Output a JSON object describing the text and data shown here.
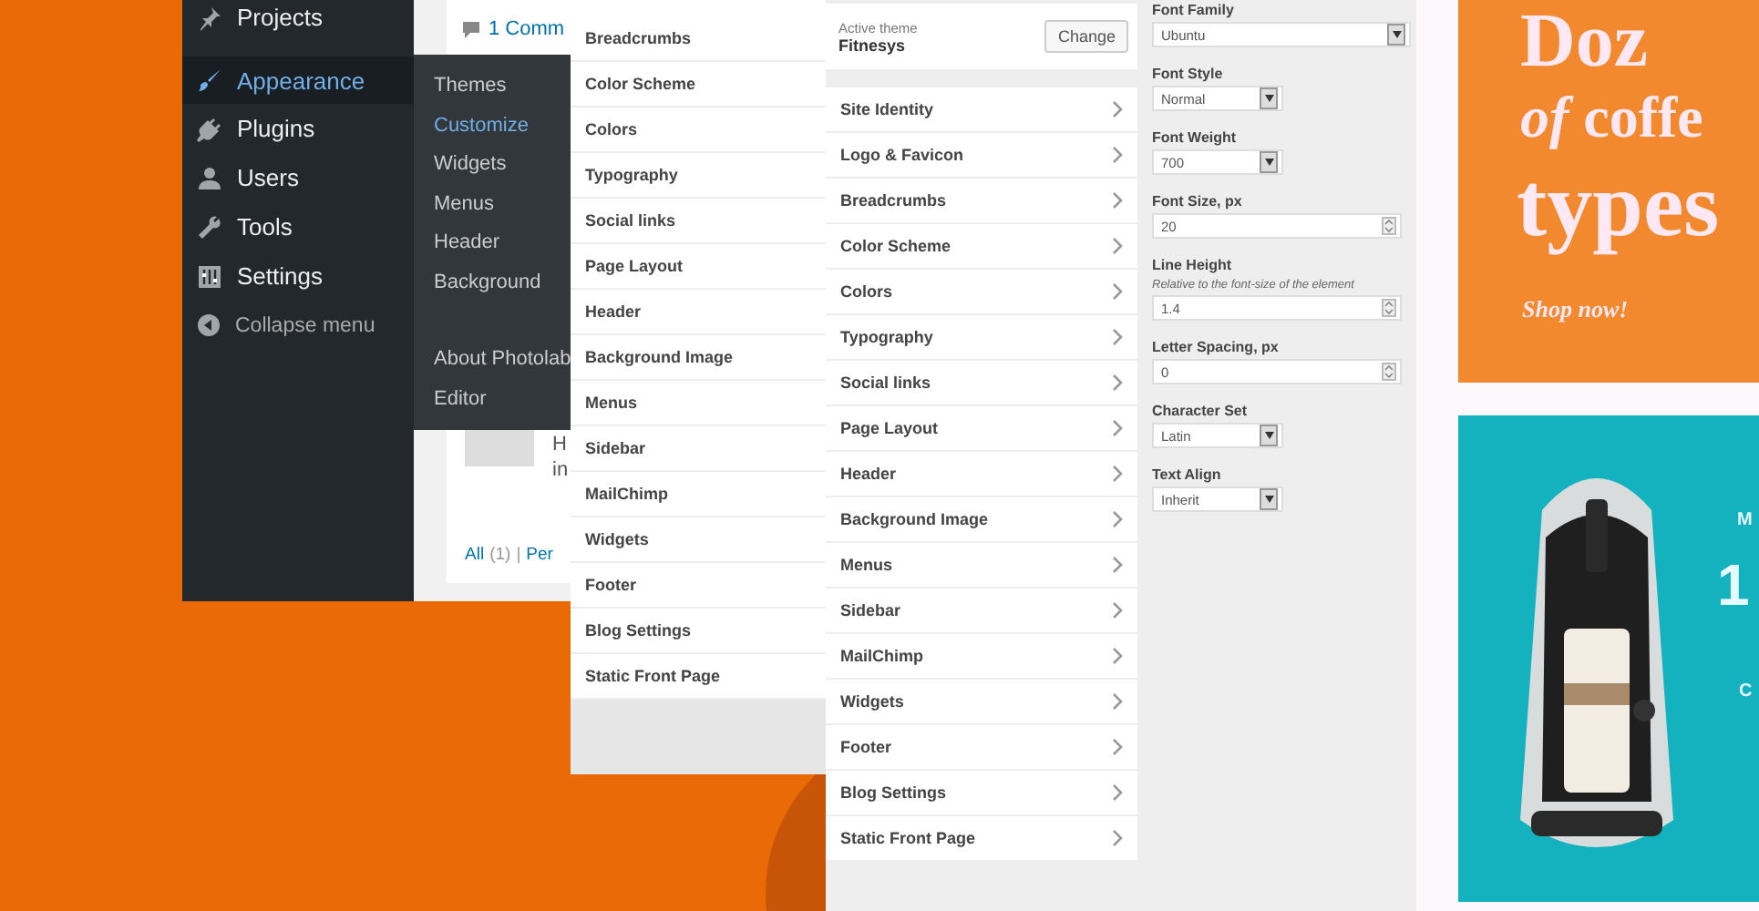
{
  "admin_menu": {
    "items": [
      {
        "label": "Projects",
        "selected": false
      },
      {
        "label": "Appearance",
        "selected": true
      },
      {
        "label": "Plugins",
        "selected": false
      },
      {
        "label": "Users",
        "selected": false
      },
      {
        "label": "Tools",
        "selected": false
      },
      {
        "label": "Settings",
        "selected": false
      }
    ],
    "collapse_label": "Collapse menu"
  },
  "appearance_submenu": {
    "items": [
      {
        "label": "Themes",
        "selected": false
      },
      {
        "label": "Customize",
        "selected": true
      },
      {
        "label": "Widgets",
        "selected": false
      },
      {
        "label": "Menus",
        "selected": false
      },
      {
        "label": "Header",
        "selected": false
      },
      {
        "label": "Background",
        "selected": false
      }
    ],
    "more_items": [
      {
        "label": "About Photolab",
        "selected": false
      },
      {
        "label": "Editor",
        "selected": false
      }
    ]
  },
  "comments": {
    "count_label": "1 Comm",
    "author": "H",
    "excerpt": "in",
    "filter_separator": "|",
    "filters": [
      {
        "label": "All",
        "count": "(1)"
      },
      {
        "label": "Per"
      }
    ]
  },
  "customizer_back_panel": {
    "sections": [
      "Breadcrumbs",
      "Color Scheme",
      "Colors",
      "Typography",
      "Social links",
      "Page Layout",
      "Header",
      "Background Image",
      "Menus",
      "Sidebar",
      "MailChimp",
      "Widgets",
      "Footer",
      "Blog Settings",
      "Static Front Page"
    ]
  },
  "customizer_panel": {
    "active_theme_label": "Active theme",
    "theme_name": "Fitnesys",
    "change_button": "Change",
    "sections": [
      "Site Identity",
      "Logo & Favicon",
      "Breadcrumbs",
      "Color Scheme",
      "Colors",
      "Typography",
      "Social links",
      "Page Layout",
      "Header",
      "Background Image",
      "Menus",
      "Sidebar",
      "MailChimp",
      "Widgets",
      "Footer",
      "Blog Settings",
      "Static Front Page"
    ]
  },
  "typography_panel": {
    "fields": [
      {
        "kind": "select",
        "label": "Font Family",
        "value": "Ubuntu"
      },
      {
        "kind": "select",
        "label": "Font Style",
        "value": "Normal"
      },
      {
        "kind": "select",
        "label": "Font Weight",
        "value": "700"
      },
      {
        "kind": "number",
        "label": "Font Size, px",
        "value": "20"
      },
      {
        "kind": "number",
        "label": "Line Height",
        "hint": "Relative to the font-size of the element",
        "value": "1.4"
      },
      {
        "kind": "number",
        "label": "Letter Spacing, px",
        "value": "0"
      },
      {
        "kind": "select",
        "label": "Character Set",
        "value": "Latin"
      },
      {
        "kind": "select",
        "label": "Text Align",
        "value": "Inherit"
      }
    ]
  },
  "promo_banner": {
    "line_1": "Doz",
    "line_2": "*of* coffe",
    "line_3": "types",
    "link": "Shop now!"
  },
  "product_banner": {
    "texts": [
      "M",
      "1",
      "C"
    ]
  }
}
